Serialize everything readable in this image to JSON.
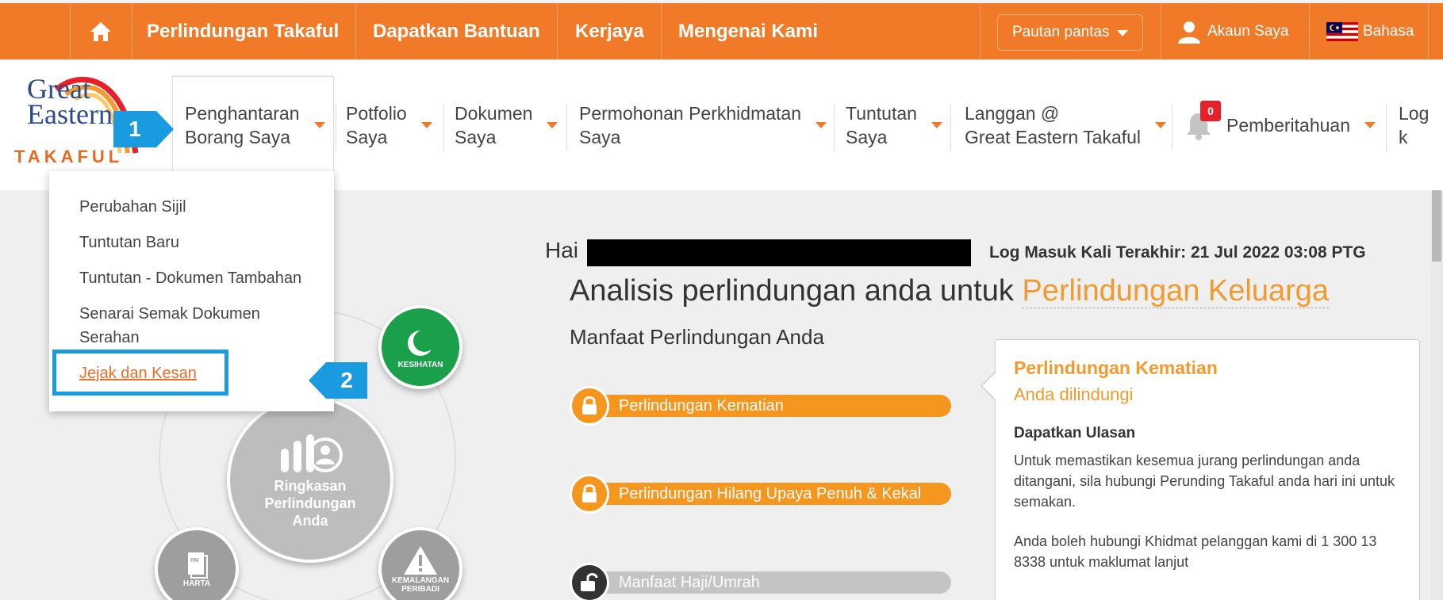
{
  "topbar": {
    "links": [
      "Perlindungan Takaful",
      "Dapatkan Bantuan",
      "Kerjaya",
      "Mengenai Kami"
    ],
    "quick_links": "Pautan pantas",
    "account": "Akaun Saya",
    "language": "Bahasa"
  },
  "logo": {
    "line1": "Great",
    "line2": "Eastern",
    "line3": "TAKAFUL"
  },
  "nav": [
    {
      "line1": "Penghantaran",
      "line2": "Borang Saya"
    },
    {
      "line1": "Potfolio",
      "line2": "Saya"
    },
    {
      "line1": "Dokumen",
      "line2": "Saya"
    },
    {
      "line1": "Permohonan Perkhidmatan",
      "line2": "Saya"
    },
    {
      "line1": "Tuntutan",
      "line2": "Saya"
    },
    {
      "line1": "Langgan @",
      "line2": "Great Eastern Takaful"
    },
    {
      "line1": "Pemberitahuan",
      "line2": ""
    },
    {
      "line1": "Log k",
      "line2": ""
    }
  ],
  "notification_count": "0",
  "markers": {
    "first": "1",
    "second": "2"
  },
  "dropdown": {
    "items": [
      "Perubahan Sijil",
      "Tuntutan Baru",
      "Tuntutan - Dokumen Tambahan",
      "Senarai Semak Dokumen",
      "Serahan",
      "Jejak dan Kesan"
    ]
  },
  "diagram": {
    "health": "KESIHATAN",
    "main_line1": "Ringkasan",
    "main_line2": "Perlindungan",
    "main_line3": "Anda",
    "harta": "HARTA",
    "kemalangan_line1": "KEMALANGAN",
    "kemalangan_line2": "PERIBADI",
    "rm": "RM"
  },
  "main": {
    "greeting": "Hai",
    "last_login": "Log Masuk Kali Terakhir: 21 Jul 2022 03:08 PTG",
    "analysis_prefix": "Analisis perlindungan anda untuk ",
    "analysis_accent": "Perlindungan Keluarga",
    "benefits_title": "Manfaat Perlindungan Anda",
    "bars": [
      "Perlindungan Kematian",
      "Perlindungan Hilang Upaya Penuh & Kekal",
      "Manfaat Haji/Umrah"
    ]
  },
  "card": {
    "title": "Perlindungan Kematian",
    "subtitle": "Anda dilindungi",
    "heading": "Dapatkan Ulasan",
    "para1": "Untuk memastikan kesemua jurang perlindungan anda ditangani, sila hubungi Perunding Takaful anda hari ini untuk semakan.",
    "para2": "Anda boleh hubungi Khidmat pelanggan kami di 1 300 13 8338 untuk maklumat lanjut"
  },
  "colors": {
    "brand_orange": "#f07a27",
    "accent_orange": "#f29a2e",
    "marker_blue": "#1a9be0",
    "health_green": "#1aa04a"
  }
}
